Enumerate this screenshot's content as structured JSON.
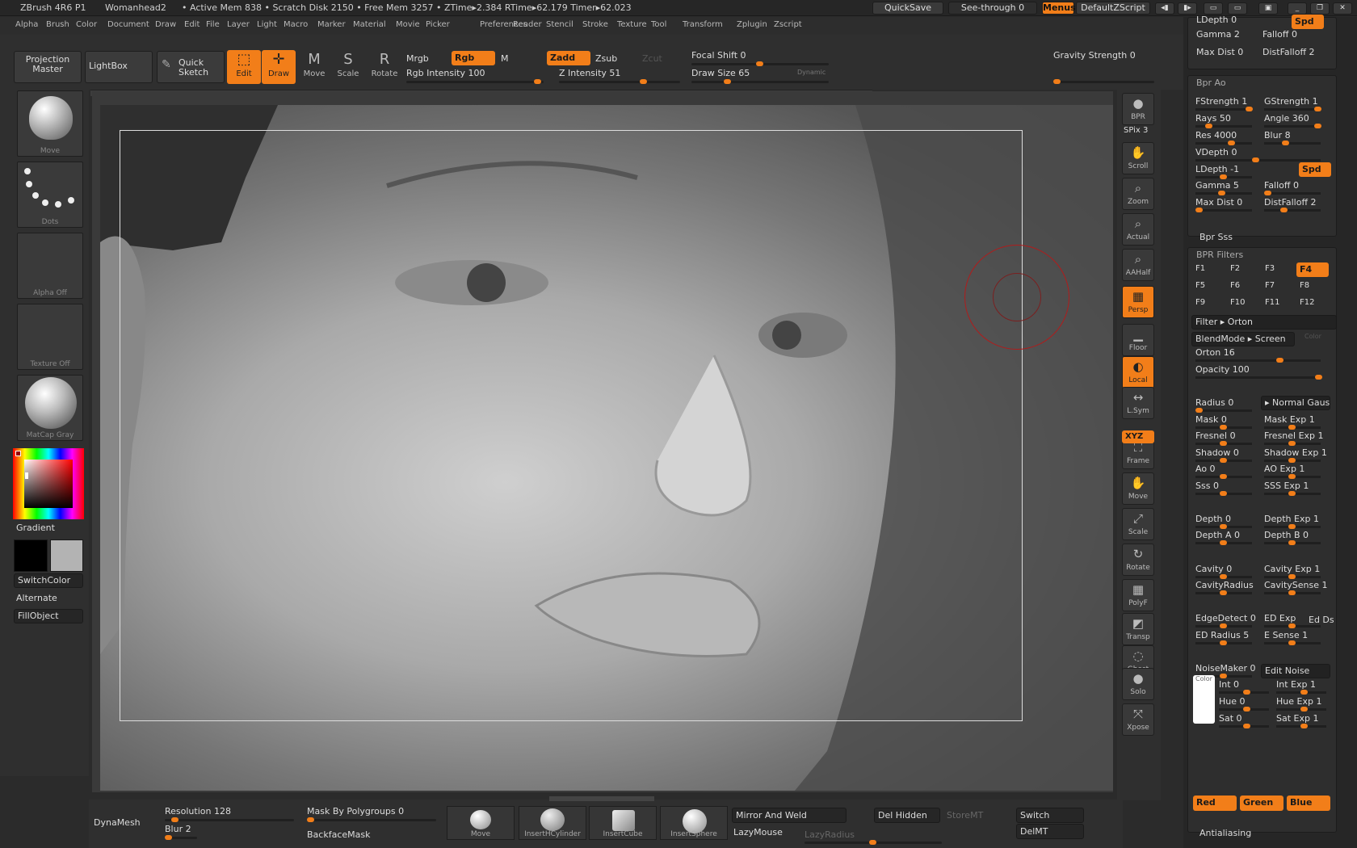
{
  "titlebar": {
    "app": "ZBrush 4R6 P1",
    "document": "Womanhead2",
    "stats": "• Active Mem 838 • Scratch Disk 2150 • Free Mem 3257 • ZTime▸2.384 RTime▸62.179 Timer▸62.023",
    "quicksave": "QuickSave",
    "seethrough": "See-through  0",
    "menus": "Menus",
    "defaultzscript": "DefaultZScript"
  },
  "menus": [
    "Alpha",
    "Brush",
    "Color",
    "Document",
    "Draw",
    "Edit",
    "File",
    "Layer",
    "Light",
    "Macro",
    "Marker",
    "Material",
    "Movie",
    "Picker",
    "Preferences",
    "Render",
    "Stencil",
    "Stroke",
    "Texture",
    "Tool",
    "Transform",
    "Zplugin",
    "Zscript"
  ],
  "shelf": {
    "projection_master": "Projection Master",
    "lightbox": "LightBox",
    "quick_sketch": "Quick Sketch",
    "modes": [
      {
        "label": "Edit",
        "active": true
      },
      {
        "label": "Draw",
        "active": true
      },
      {
        "label": "Move",
        "active": false
      },
      {
        "label": "Scale",
        "active": false
      },
      {
        "label": "Rotate",
        "active": false
      }
    ],
    "mrgb": "Mrgb",
    "rgb": "Rgb",
    "m": "M",
    "zadd": "Zadd",
    "zsub": "Zsub",
    "zcut": "Zcut",
    "rgb_intensity": "Rgb Intensity 100",
    "z_intensity": "Z Intensity 51",
    "focal_shift": "Focal Shift 0",
    "draw_size": "Draw Size 65",
    "dynamic": "Dynamic",
    "gravity": "Gravity Strength 0"
  },
  "left": {
    "thumbs": [
      "Move",
      "Dots",
      "Alpha Off",
      "Texture Off",
      "MatCap Gray"
    ],
    "gradient": "Gradient",
    "switchcolor": "SwitchColor",
    "alternate": "Alternate",
    "fillobject": "FillObject"
  },
  "right": {
    "buttons": [
      {
        "label": "BPR",
        "icon": "●",
        "active": false
      },
      {
        "label": "Scroll",
        "icon": "✋",
        "active": false
      },
      {
        "label": "Zoom",
        "icon": "⌕",
        "active": false
      },
      {
        "label": "Actual",
        "icon": "⌕",
        "active": false
      },
      {
        "label": "AAHalf",
        "icon": "⌕",
        "active": false
      },
      {
        "label": "Persp",
        "icon": "▦",
        "active": true
      },
      {
        "label": "Floor",
        "icon": "▁",
        "active": false
      },
      {
        "label": "Local",
        "icon": "◐",
        "active": true
      },
      {
        "label": "L.Sym",
        "icon": "↔",
        "active": false
      },
      {
        "label": "Frame",
        "icon": "⛶",
        "active": false
      },
      {
        "label": "Move",
        "icon": "✋",
        "active": false
      },
      {
        "label": "Scale",
        "icon": "⤢",
        "active": false
      },
      {
        "label": "Rotate",
        "icon": "↻",
        "active": false
      },
      {
        "label": "PolyF",
        "icon": "▦",
        "active": false
      },
      {
        "label": "Transp",
        "icon": "◩",
        "active": false
      },
      {
        "label": "Ghost",
        "icon": "◌",
        "active": false
      },
      {
        "label": "Solo",
        "icon": "●",
        "active": false
      },
      {
        "label": "Xpose",
        "icon": "⤧",
        "active": false
      }
    ],
    "spix": "SPix 3",
    "xyz": "XYZ"
  },
  "panel": {
    "top": {
      "ldepth": "LDepth 0",
      "spd": "Spd",
      "gamma": "Gamma 2",
      "falloff": "Falloff 0",
      "maxdist": "Max Dist 0",
      "distfalloff": "DistFalloff 2"
    },
    "bprao": {
      "title": "Bpr Ao",
      "fstrength": "FStrength 1",
      "gstrength": "GStrength 1",
      "rays": "Rays 50",
      "angle": "Angle 360",
      "res": "Res 4000",
      "blur": "Blur 8",
      "vdepth": "VDepth 0",
      "ldepth": "LDepth -1",
      "spd": "Spd",
      "gamma": "Gamma 5",
      "falloff": "Falloff 0",
      "maxdist": "Max Dist 0",
      "distfalloff": "DistFalloff 2"
    },
    "bprsss": "Bpr Sss",
    "filters": {
      "title": "BPR Filters",
      "f": [
        "F1",
        "F2",
        "F3",
        "F4",
        "F5",
        "F6",
        "F7",
        "F8",
        "F9",
        "F10",
        "F11",
        "F12"
      ],
      "filter": "Filter ▸ Orton",
      "blendmode": "BlendMode ▸ Screen",
      "color": "Color",
      "orton": "Orton 16",
      "opacity": "Opacity 100",
      "radius": "Radius 0",
      "normalgaus": "▸ Normal Gaus",
      "mask": "Mask 0",
      "maskexp": "Mask Exp 1",
      "fresnel": "Fresnel 0",
      "fresnelexp": "Fresnel Exp 1",
      "shadow": "Shadow 0",
      "shadowexp": "Shadow Exp 1",
      "ao": "Ao 0",
      "aoexp": "AO Exp 1",
      "sss": "Sss 0",
      "sssexp": "SSS Exp 1",
      "depth": "Depth 0",
      "depthexp": "Depth Exp 1",
      "deptha": "Depth A 0",
      "depthb": "Depth B 0",
      "cavity": "Cavity 0",
      "cavityexp": "Cavity Exp 1",
      "cavityradius": "CavityRadius",
      "cavitysense": "CavitySense 1",
      "edgedetect": "EdgeDetect 0",
      "edexp": "ED Exp",
      "edds": "Ed Ds",
      "edradius": "ED Radius 5",
      "esense": "E Sense 1",
      "noisemaker": "NoiseMaker 0",
      "editnoise": "Edit Noise",
      "colorlbl": "Color",
      "int": "Int 0",
      "intexp": "Int Exp 1",
      "hue": "Hue 0",
      "hueexp": "Hue Exp 1",
      "sat": "Sat 0",
      "satexp": "Sat Exp 1",
      "red": "Red",
      "green": "Green",
      "blue": "Blue"
    },
    "antialiasing": "Antialiasing"
  },
  "bottom": {
    "dynamesh": "DynaMesh",
    "resolution": "Resolution 128",
    "blur": "Blur 2",
    "maskbypoly": "Mask By Polygroups 0",
    "backfacemask": "BackfaceMask",
    "inserts": [
      "Move",
      "InsertHCylinder",
      "InsertCube",
      "InsertSphere"
    ],
    "mirror": "Mirror And Weld",
    "lazymouse": "LazyMouse",
    "lazyradius": "LazyRadius",
    "delhidden": "Del Hidden",
    "storemt": "StoreMT",
    "switch": "Switch",
    "delmt": "DelMT"
  },
  "colors": {
    "accent": "#f27e19",
    "bg": "#2b2b2b"
  }
}
